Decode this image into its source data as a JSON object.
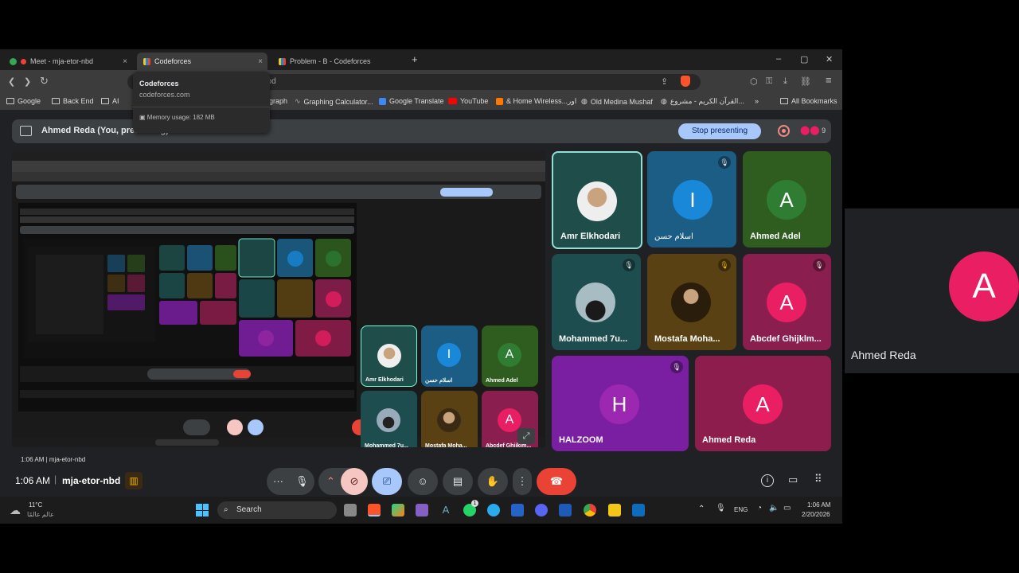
{
  "browser": {
    "tabs": [
      {
        "label": "Meet - mja-etor-nbd",
        "close": "×"
      },
      {
        "label": "Codeforces",
        "close": "×"
      },
      {
        "label": "Problem - B - Codeforces"
      }
    ],
    "new_tab": "+",
    "window_controls": {
      "minimize": "–",
      "maximize": "▢",
      "close": "✕"
    },
    "address_fragment": "nbd",
    "tooltip": {
      "title": "Codeforces",
      "url": "codeforces.com",
      "memory": "Memory usage: 182 MB"
    },
    "bookmarks": [
      "Google",
      "Back End",
      "AI",
      "graph",
      "Graphing Calculator...",
      "Google Translate",
      "YouTube",
      "& Home Wireless...اور",
      "Old Medina Mushaf",
      "القرآن الكريم - مشروع...",
      "»",
      "All Bookmarks"
    ]
  },
  "meet": {
    "presenting_label": "Ahmed Reda (You, presenting)",
    "stop_presenting": "Stop presenting",
    "participant_count": "9",
    "time": "1:06 AM",
    "meeting_code": "mja-etor-nbd",
    "participants": [
      {
        "name": "Amr Elkhodari",
        "initial": "",
        "color": "#1e4d4a"
      },
      {
        "name": "اسلام حسن",
        "initial": "I",
        "color": "#1c5d86"
      },
      {
        "name": "Ahmed Adel",
        "initial": "A",
        "color": "#2f5d1f"
      },
      {
        "name": "Mohammed 7u...",
        "initial": "",
        "color": "#1d4d4f"
      },
      {
        "name": "Mostafa Moha...",
        "initial": "",
        "color": "#5a4113"
      },
      {
        "name": "Abcdef Ghijklm...",
        "initial": "A",
        "color": "#8a1e4e"
      },
      {
        "name": "HALZOOM",
        "initial": "H",
        "color": "#7b1fa2"
      },
      {
        "name": "Ahmed Reda",
        "initial": "A",
        "color": "#8d1d4c"
      }
    ],
    "side_participant": {
      "name": "Ahmed Reda",
      "initial": "A"
    },
    "colors": {
      "avatar_pink": "#e91e63",
      "avatar_purple": "#9c27b0",
      "avatar_blue": "#1a88d8",
      "avatar_green": "#2e7d32",
      "end_call": "#ea4335",
      "stop_btn": "#a8c7fa"
    }
  },
  "taskbar": {
    "weather_temp": "11°C",
    "weather_text": "عالم عالمًا",
    "search": "Search",
    "lang": "ENG",
    "clock_time": "1:06 AM",
    "clock_date": "2/20/2026",
    "notif_badge": "1"
  }
}
